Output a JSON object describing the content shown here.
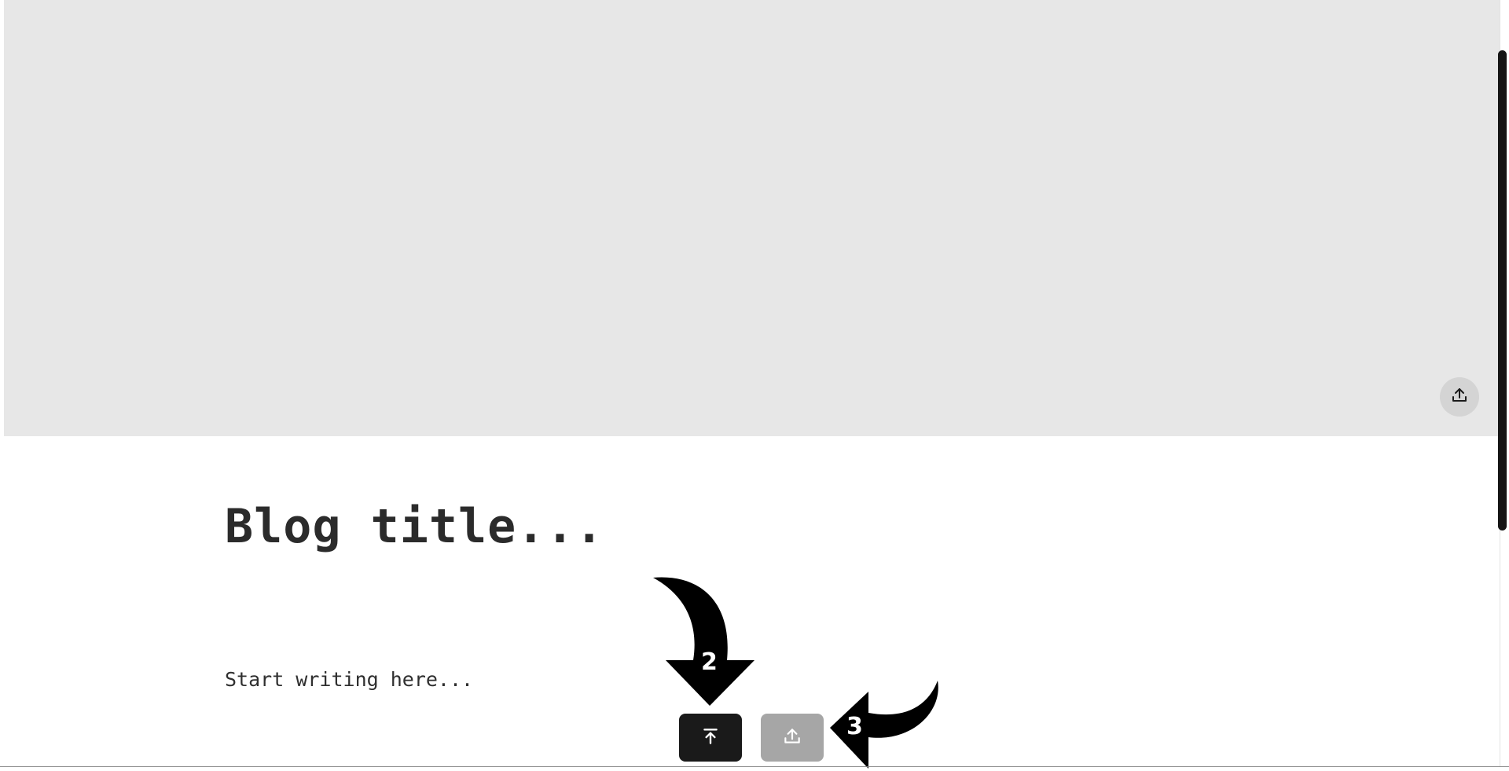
{
  "editor": {
    "title_placeholder": "Blog title...",
    "body_placeholder": "Start writing here..."
  },
  "cover": {
    "upload_icon": "upload-icon",
    "background_color": "#e7e7e7"
  },
  "toolbar": {
    "publish_icon": "arrow-up-to-line-icon",
    "upload_icon": "upload-icon",
    "publish_color": "#1a1a1a",
    "upload_color": "#a6a6a6"
  },
  "annotations": {
    "step_2": "2",
    "step_3": "3"
  }
}
